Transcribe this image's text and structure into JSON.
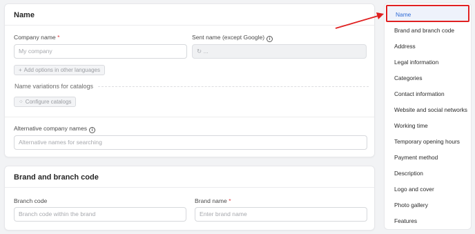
{
  "name_card": {
    "title": "Name",
    "company_name_label": "Company name",
    "required_mark": "*",
    "company_name_placeholder": "My company",
    "sent_name_label": "Sent name (except Google)",
    "sent_name_value": "...",
    "add_languages_button": "Add options in other languages",
    "catalog_variations_title": "Name variations for catalogs",
    "configure_catalogs_button": "Configure catalogs",
    "alt_names_label": "Alternative company names",
    "alt_names_placeholder": "Alternative names for searching"
  },
  "brand_card": {
    "title": "Brand and branch code",
    "branch_code_label": "Branch code",
    "branch_code_placeholder": "Branch code within the brand",
    "brand_name_label": "Brand name",
    "required_mark": "*",
    "brand_name_placeholder": "Enter brand name"
  },
  "nav": {
    "active": "Name",
    "items": [
      "Brand and branch code",
      "Address",
      "Legal information",
      "Categories",
      "Contact information",
      "Website and social networks",
      "Working time",
      "Temporary opening hours",
      "Payment method",
      "Description",
      "Logo and cover",
      "Photo gallery",
      "Features"
    ]
  },
  "colors": {
    "accent": "#2e6bd6",
    "highlight_annotation": "#e02020",
    "required": "#e0393e"
  },
  "icons": {
    "info": "info-circle-icon",
    "plus": "plus-icon",
    "grid": "grid-icon",
    "refresh": "refresh-icon"
  }
}
